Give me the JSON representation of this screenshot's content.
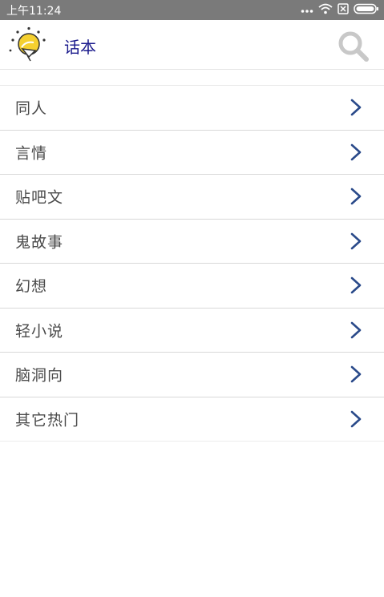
{
  "status_bar": {
    "time": "上午11:24",
    "icons": [
      "dots-icon",
      "wifi-icon",
      "sim-x-icon",
      "battery-icon"
    ]
  },
  "app_bar": {
    "title": "话本",
    "logo_icon": "lightbulb-logo-icon",
    "search_icon": "search-icon"
  },
  "categories": [
    {
      "label": "同人"
    },
    {
      "label": "言情"
    },
    {
      "label": "贴吧文"
    },
    {
      "label": "鬼故事"
    },
    {
      "label": "幻想"
    },
    {
      "label": "轻小说"
    },
    {
      "label": "脑洞向"
    },
    {
      "label": "其它热门"
    }
  ],
  "colors": {
    "status_bar_bg": "#7a7a7a",
    "title": "#1a1a8c",
    "chevron": "#2a4a8a",
    "item_text": "#4a4a4a",
    "search_icon": "#c8c8c8"
  }
}
